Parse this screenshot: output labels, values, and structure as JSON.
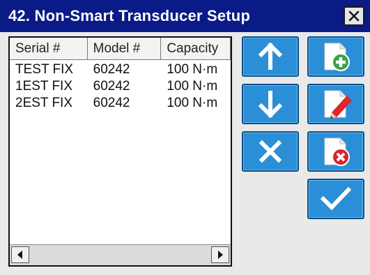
{
  "window": {
    "title": "42. Non-Smart Transducer Setup",
    "close_icon": "close-icon"
  },
  "table": {
    "columns": [
      "Serial #",
      "Model #",
      "Capacity"
    ],
    "rows": [
      [
        "TEST FIX",
        "60242",
        "100 N·m"
      ],
      [
        "1EST FIX",
        "60242",
        "100 N·m"
      ],
      [
        "2EST FIX",
        "60242",
        "100 N·m"
      ]
    ]
  },
  "scrollbar": {
    "left_icon": "scroll-left-icon",
    "right_icon": "scroll-right-icon"
  },
  "actions": [
    {
      "name": "move-up-button",
      "icon": "arrow-up-icon"
    },
    {
      "name": "add-button",
      "icon": "add-document-icon"
    },
    {
      "name": "move-down-button",
      "icon": "arrow-down-icon"
    },
    {
      "name": "edit-button",
      "icon": "edit-document-icon"
    },
    {
      "name": "cancel-button",
      "icon": "x-icon"
    },
    {
      "name": "delete-button",
      "icon": "delete-document-icon"
    },
    {
      "name": "confirm-button",
      "icon": "checkmark-icon"
    }
  ],
  "colors": {
    "titlebar": "#0a1a86",
    "button": "#2a8fd6",
    "button_border": "#0c4f88",
    "add_green": "#3aa14a",
    "delete_red": "#d8252b",
    "edit_red": "#e0252b"
  }
}
